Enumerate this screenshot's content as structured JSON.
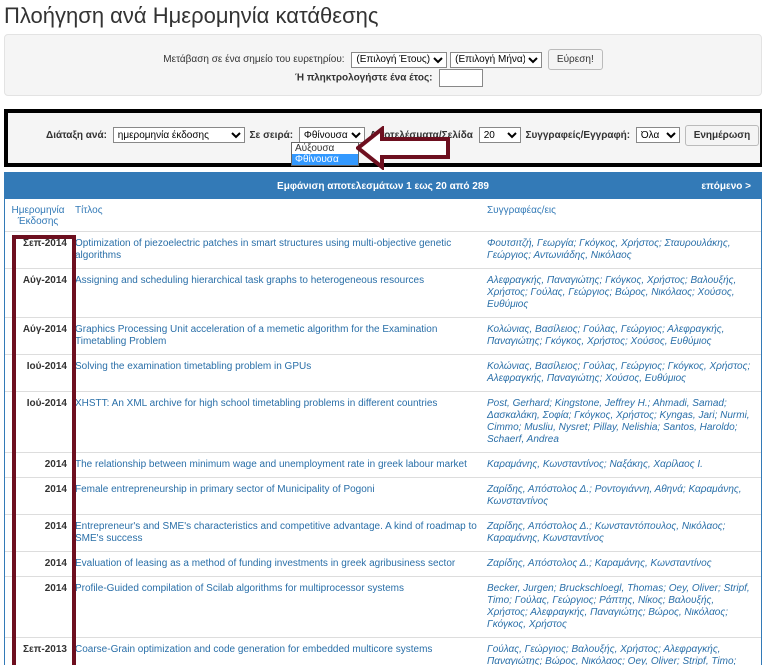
{
  "page_title": "Πλοήγηση ανά Ημερομηνία κατάθεσης",
  "browse": {
    "jump_label": "Μετάβαση σε ένα σημείο του ευρετηρίου:",
    "year_select": "(Επιλογή Έτους)",
    "month_select": "(Επιλογή Μήνα)",
    "find_button": "Εύρεση!",
    "year_input_label": "Ή πληκτρολογήστε ένα έτος:",
    "year_input_value": ""
  },
  "sort": {
    "sort_by_label": "Διάταξη ανά:",
    "sort_by_value": "ημερομηνία έκδοσης",
    "order_label": "Σε σειρά:",
    "order_value": "Φθίνουσα",
    "order_options": [
      "Αύξουσα",
      "Φθίνουσα"
    ],
    "rpp_label": "Αποτελέσματα/Σελίδα",
    "rpp_value": "20",
    "authors_label": "Συγγραφείς/Εγγραφή:",
    "authors_value": "Όλα",
    "update_button": "Ενημέρωση"
  },
  "results": {
    "summary": "Εμφάνιση αποτελεσμάτων 1 εως 20 από 289",
    "next_link": "επόμενο >",
    "headers": {
      "date": "Ημερομηνία Έκδοσης",
      "title": "Τίτλος",
      "authors": "Συγγραφέας/εις"
    },
    "rows": [
      {
        "date": "Σεπ-2014",
        "title": "Optimization of piezoelectric patches in smart structures using multi-objective genetic algorithms",
        "authors": "Φουτσιτζή, Γεωργία; Γκόγκος, Χρήστος; Σταυρουλάκης, Γεώργιος; Αντωνιάδης, Νικόλαος"
      },
      {
        "date": "Αύγ-2014",
        "title": "Assigning and scheduling hierarchical task graphs to heterogeneous resources",
        "authors": "Αλεφραγκής, Παναγιώτης; Γκόγκος, Χρήστος; Βαλουξής, Χρήστος; Γούλας, Γεώργιος; Βώρος, Νικόλαος; Χούσος, Ευθύμιος"
      },
      {
        "date": "Αύγ-2014",
        "title": "Graphics Processing Unit acceleration of a memetic algorithm for the Examination Timetabling Problem",
        "authors": "Κολώνιας, Βασίλειος; Γούλας, Γεώργιος; Αλεφραγκής, Παναγιώτης; Γκόγκος, Χρήστος; Χούσος, Ευθύμιος"
      },
      {
        "date": "Ιού-2014",
        "title": "Solving the examination timetabling problem in GPUs",
        "authors": "Κολώνιας, Βασίλειος; Γούλας, Γεώργιος; Γκόγκος, Χρήστος; Αλεφραγκής, Παναγιώτης; Χούσος, Ευθύμιος"
      },
      {
        "date": "Ιού-2014",
        "title": "XHSTT: An XML archive for high school timetabling problems in different countries",
        "authors": "Post, Gerhard; Kingstone, Jeffrey H.; Ahmadi, Samad; Δασκαλάκη, Σοφία; Γκόγκος, Χρήστος; Kyngas, Jari; Nurmi, Cimmo; Musliu, Nysret; Pillay, Nelishia; Santos, Haroldo; Schaerf, Andrea"
      },
      {
        "date": "2014",
        "title": "The relationship between minimum wage and unemployment rate in greek labour market",
        "authors": "Καραμάνης, Κωνσταντίνος; Ναξάκης, Χαρίλαος Ι."
      },
      {
        "date": "2014",
        "title": "Female entrepreneurship in primary sector of Municipality of Pogoni",
        "authors": "Ζαρίδης, Απόστολος Δ.; Ροντογιάννη, Αθηνά; Καραμάνης, Κωνσταντίνος"
      },
      {
        "date": "2014",
        "title": "Entrepreneur's and SME's characteristics and competitive advantage. A kind of roadmap to SME's success",
        "authors": "Ζαρίδης, Απόστολος Δ.; Κωνσταντόπουλος, Νικόλαος; Καραμάνης, Κωνσταντίνος"
      },
      {
        "date": "2014",
        "title": "Evaluation of leasing as a method of funding investments in greek agribusiness sector",
        "authors": "Ζαρίδης, Απόστολος Δ.; Καραμάνης, Κωνσταντίνος"
      },
      {
        "date": "2014",
        "title": "Profile-Guided compilation of Scilab algorithms for multiprocessor systems",
        "authors": "Becker, Jurgen; Bruckschloegl, Thomas; Oey, Oliver; Stripf, Timo; Γούλας, Γεώργιος; Ράπτης, Νίκος; Βαλουξής, Χρήστος; Αλεφραγκής, Παναγιώτης; Βώρος, Νικόλαος; Γκόγκος, Χρήστος"
      },
      {
        "date": "Σεπ-2013",
        "title": "Coarse-Grain optimization and code generation for embedded multicore systems",
        "authors": "Γούλας, Γεώργιος; Βαλουξής, Χρήστος; Αλεφραγκής, Παναγιώτης; Βώρος, Νικόλαος; Oey, Oliver; Stripf, Timo; Bruckschloegl, Thomas; Becker, Jurgen; Γκόγκος, Χρήστος; El Moussawi, A.; Naullet, M.; Yuki, T."
      }
    ]
  }
}
